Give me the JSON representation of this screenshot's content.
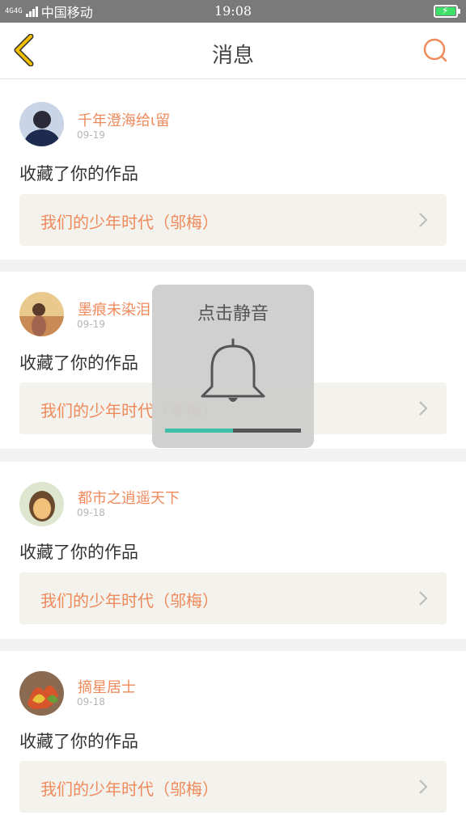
{
  "status_bar": {
    "network_type": "4G4G",
    "carrier": "中国移动",
    "time": "19:08"
  },
  "header": {
    "title": "消息",
    "back_icon": "chevron-left-icon",
    "search_icon": "search-icon"
  },
  "feed": [
    {
      "user_name": "千年澄海给ι留",
      "date": "09-19",
      "action": "收藏了你的作品",
      "work_title": "我们的少年时代（邬梅）",
      "avatar_colors": [
        "#1d2b4f",
        "#c9d4e6"
      ]
    },
    {
      "user_name": "墨痕未染泪",
      "date": "09-19",
      "action": "收藏了你的作品",
      "work_title": "我们的少年时代（邬梅）",
      "avatar_colors": [
        "#e9c98e",
        "#a0654e"
      ]
    },
    {
      "user_name": "都市之逍遥天下",
      "date": "09-18",
      "action": "收藏了你的作品",
      "work_title": "我们的少年时代（邬梅）",
      "avatar_colors": [
        "#f3c27a",
        "#6b4a2e"
      ]
    },
    {
      "user_name": "摘星居士",
      "date": "09-18",
      "action": "收藏了你的作品",
      "work_title": "我们的少年时代（邬梅）",
      "avatar_colors": [
        "#d8542a",
        "#6b9c3a"
      ]
    }
  ],
  "mute_overlay": {
    "label": "点击静音",
    "icon": "bell-icon",
    "volume_level": 0.5,
    "accent_color": "#3fbfa8"
  },
  "colors": {
    "accent": "#ef8a5c",
    "back_arrow": "#f0c000",
    "card_link_bg": "#f3f2ec"
  }
}
